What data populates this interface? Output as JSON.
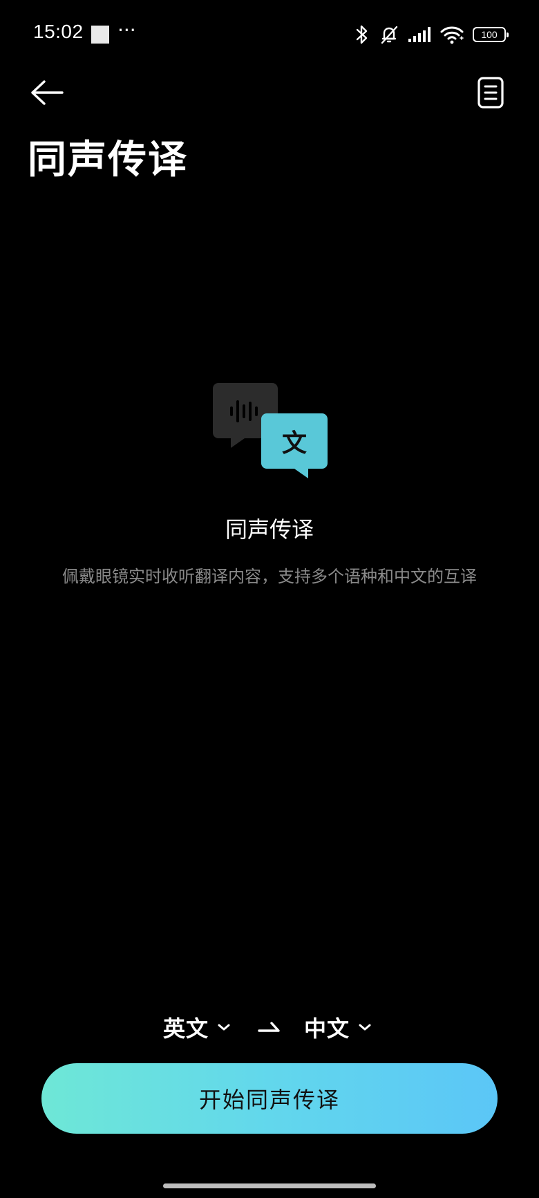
{
  "status_bar": {
    "time": "15:02",
    "more": "···",
    "battery": "100"
  },
  "header": {
    "title": "同声传译"
  },
  "empty_state": {
    "icon_glyph": "文",
    "title": "同声传译",
    "description": "佩戴眼镜实时收听翻译内容，支持多个语种和中文的互译"
  },
  "language_selector": {
    "source": "英文",
    "target": "中文"
  },
  "start_button": {
    "label": "开始同声传译"
  },
  "colors": {
    "background": "#000000",
    "accent_start": "#6ee7d6",
    "accent_end": "#5bc6f7",
    "bubble_teal": "#59c8d8",
    "bubble_gray": "#2c2c2c",
    "muted_text": "#8a8a8a"
  }
}
